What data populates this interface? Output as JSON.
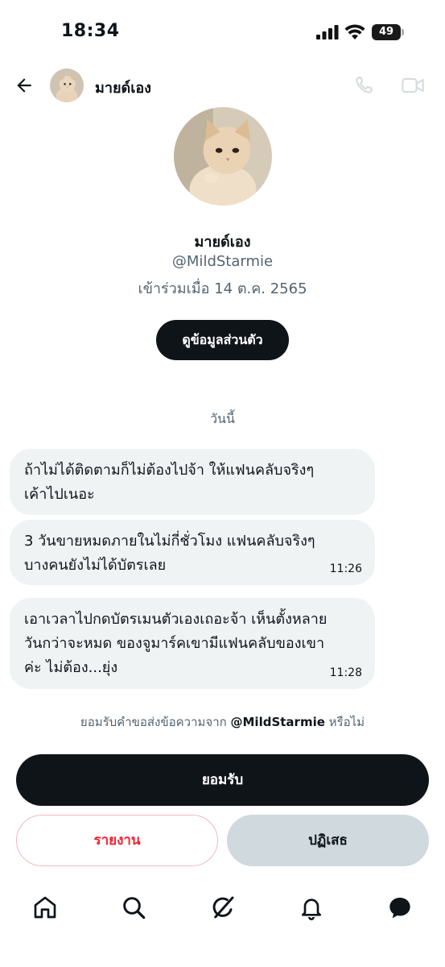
{
  "status_bar": {
    "time": "18:34",
    "battery": "49",
    "icons": [
      "signal-icon",
      "wifi-icon",
      "battery-icon"
    ]
  },
  "header": {
    "name": "มายด์เอง",
    "icons": [
      "back-arrow-icon",
      "phone-icon",
      "video-camera-icon"
    ]
  },
  "profile": {
    "name": "มายด์เอง",
    "handle": "@MildStarmie",
    "joined": "เข้าร่วมเมื่อ 14 ต.ค. 2565",
    "view_profile_label": "ดูข้อมูลส่วนตัว"
  },
  "conversation": {
    "date_separator": "วันนี้",
    "messages": [
      {
        "lines": [
          "ถ้าไม่ได้ติดตามก็ไม่ต้องไปจ้า ให้แฟนคลับจริงๆ",
          "เค้าไปเนอะ"
        ],
        "time": ""
      },
      {
        "lines": [
          "3 วันขายหมดภายในไม่กี่ชั่วโมง แฟนคลับจริงๆ",
          "บางคนยังไม่ได้บัตรเลย"
        ],
        "time": "11:26"
      },
      {
        "lines": [
          "เอาเวลาไปกดบัตรเมนตัวเองเถอะจ้า เห็นตั้งหลาย",
          "วันกว่าจะหมด ของจูมาร์คเขามีแฟนคลับของเขา",
          "ค่ะ ไม่ต้อง...ยุ่ง"
        ],
        "time": "11:28"
      }
    ]
  },
  "request": {
    "question_prefix": "ยอมรับคำขอส่งข้อความจาก",
    "question_handle": "@MildStarmie",
    "question_suffix": "หรือไม่",
    "accept_label": "ยอมรับ",
    "report_label": "รายงาน",
    "decline_label": "ปฏิเสธ"
  },
  "bottom_nav": {
    "items": [
      "home-icon",
      "search-icon",
      "grok-icon",
      "notifications-bell-icon",
      "messages-icon"
    ]
  },
  "colors": {
    "text": "#0f1419",
    "secondary_text": "#536471",
    "bubble": "#eff3f4",
    "danger": "#f4212e",
    "decline_bg": "#cfd9de"
  }
}
